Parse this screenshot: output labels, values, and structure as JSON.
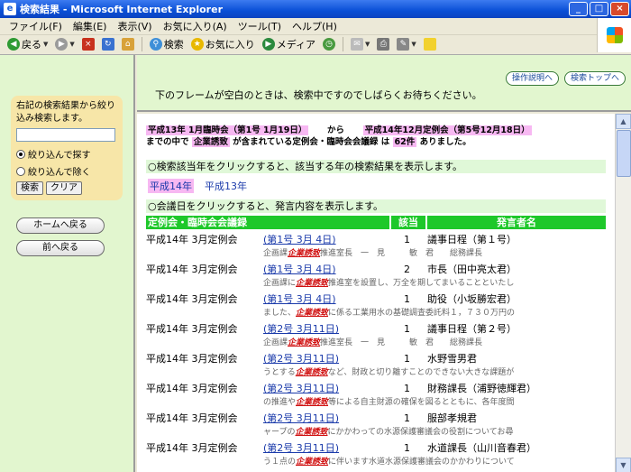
{
  "window": {
    "title": "検索結果 - Microsoft Internet Explorer"
  },
  "menu": [
    "ファイル(F)",
    "編集(E)",
    "表示(V)",
    "お気に入り(A)",
    "ツール(T)",
    "ヘルプ(H)"
  ],
  "toolbar": {
    "back": "戻る",
    "search": "検索",
    "favorites": "お気に入り",
    "media": "メディア"
  },
  "left": {
    "instruction": "右記の検索結果から絞り込み検索します。",
    "input_value": "",
    "radio_include": "絞り込んで探す",
    "radio_exclude": "絞り込んで除く",
    "btn_search": "検索",
    "btn_clear": "クリア",
    "btn_home": "ホームへ戻る",
    "btn_back": "前へ戻る"
  },
  "top": {
    "btn_manual": "操作説明へ",
    "btn_search_top": "検索トップへ",
    "message": "下のフレームが空白のときは、検索中ですのでしばらくお待ちください。"
  },
  "criteria": {
    "from": "平成13年 1月臨時会（第1号 1月19日）",
    "from_word": "から",
    "to": "平成14年12月定例会（第5号12月18日）",
    "line2_a": "までの中で",
    "keyword": "企業誘致",
    "line2_b": "が含まれている定例会・臨時会会議録",
    "line2_c": "は",
    "count": "62件",
    "line2_d": "ありました。"
  },
  "instructions": {
    "year": "○検索該当年をクリックすると、該当する年の検索結果を表示します。",
    "date": "○会議日をクリックすると、発言内容を表示します。"
  },
  "years": [
    "平成14年",
    "平成13年"
  ],
  "table": {
    "headers": [
      "定例会・臨時会会議録",
      "該当",
      "発言者名"
    ],
    "rows": [
      {
        "meeting": "平成14年 3月定例会",
        "date": "(第1号 3月 4日)",
        "count": "1",
        "speaker": "議事日程（第１号）",
        "snip_a": "企画課",
        "snip_kw": "企業誘致",
        "snip_b": "推進室長　一　見　　　敏　君　　総務課長"
      },
      {
        "meeting": "平成14年 3月定例会",
        "date": "(第1号 3月 4日)",
        "count": "2",
        "speaker": "市長（田中亮太君）",
        "snip_a": "企画課に",
        "snip_kw": "企業誘致",
        "snip_b": "推進室を設置し、万全を期してまいることといたし"
      },
      {
        "meeting": "平成14年 3月定例会",
        "date": "(第1号 3月 4日)",
        "count": "1",
        "speaker": "助役（小坂勝宏君）",
        "snip_a": "ました、",
        "snip_kw": "企業誘致",
        "snip_b": "に係る工業用水の基礎調査委託料１，７３０万円の"
      },
      {
        "meeting": "平成14年 3月定例会",
        "date": "(第2号 3月11日)",
        "count": "1",
        "speaker": "議事日程（第２号）",
        "snip_a": "企画課",
        "snip_kw": "企業誘致",
        "snip_b": "推進室長　一　見　　　敏　君　　総務課長"
      },
      {
        "meeting": "平成14年 3月定例会",
        "date": "(第2号 3月11日)",
        "count": "1",
        "speaker": "水野雪男君",
        "snip_a": "うとする",
        "snip_kw": "企業誘致",
        "snip_b": "など、財政と切り離すことのできない大きな課題が"
      },
      {
        "meeting": "平成14年 3月定例会",
        "date": "(第2号 3月11日)",
        "count": "1",
        "speaker": "財務課長（浦野徳輝君）",
        "snip_a": "の推進や",
        "snip_kw": "企業誘致",
        "snip_b": "等による自主財源の確保を図るとともに、各年度間"
      },
      {
        "meeting": "平成14年 3月定例会",
        "date": "(第2号 3月11日)",
        "count": "1",
        "speaker": "服部孝規君",
        "snip_a": "ャープの",
        "snip_kw": "企業誘致",
        "snip_b": "にかかわっての水源保護審議会の役割についてお尋"
      },
      {
        "meeting": "平成14年 3月定例会",
        "date": "(第2号 3月11日)",
        "count": "1",
        "speaker": "水道課長（山川音春君）",
        "snip_a": "う１点の",
        "snip_kw": "企業誘致",
        "snip_b": "に伴います水道水源保護審議会のかかわりについて"
      }
    ]
  }
}
